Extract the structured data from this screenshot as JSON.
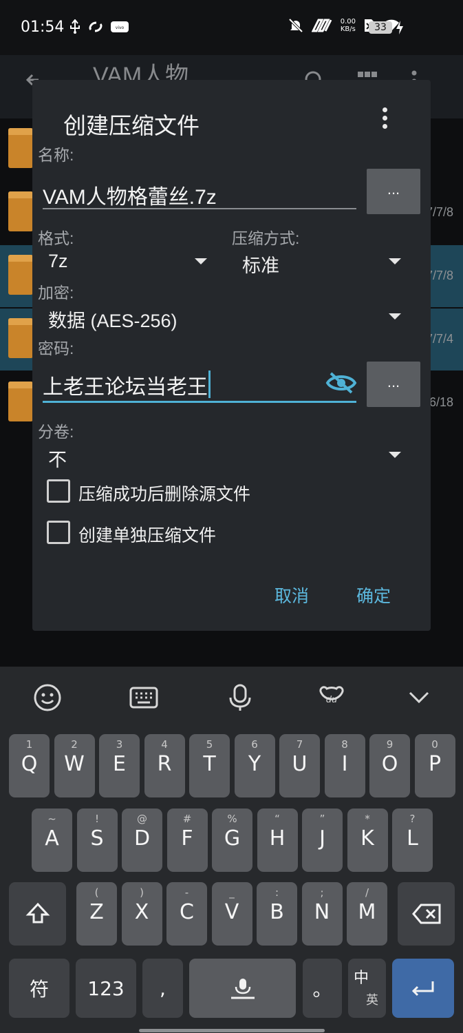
{
  "status_bar": {
    "time": "01:54",
    "net_speed_value": "0.00",
    "net_speed_unit": "KB/s",
    "battery": "33"
  },
  "background_app": {
    "title": "VAM人物",
    "dates": [
      "7/7/8",
      "7/7/8",
      "7/7/4",
      "6/18"
    ]
  },
  "dialog": {
    "title": "创建压缩文件",
    "name_label": "名称:",
    "name_value": "VAM人物格蕾丝.7z",
    "browse_label": "...",
    "format_label": "格式:",
    "format_value": "7z",
    "method_label": "压缩方式:",
    "method_value": "标准",
    "encryption_label": "加密:",
    "encryption_value": "数据 (AES-256)",
    "password_label": "密码:",
    "password_value": "上老王论坛当老王",
    "split_label": "分卷:",
    "split_value": "不",
    "checkbox_delete": "压缩成功后删除源文件",
    "checkbox_separate": "创建单独压缩文件",
    "cancel": "取消",
    "ok": "确定"
  },
  "keyboard": {
    "row1": [
      {
        "main": "Q",
        "sub": "1"
      },
      {
        "main": "W",
        "sub": "2"
      },
      {
        "main": "E",
        "sub": "3"
      },
      {
        "main": "R",
        "sub": "4"
      },
      {
        "main": "T",
        "sub": "5"
      },
      {
        "main": "Y",
        "sub": "6"
      },
      {
        "main": "U",
        "sub": "7"
      },
      {
        "main": "I",
        "sub": "8"
      },
      {
        "main": "O",
        "sub": "9"
      },
      {
        "main": "P",
        "sub": "0"
      }
    ],
    "row2": [
      {
        "main": "A",
        "sub": "~"
      },
      {
        "main": "S",
        "sub": "!"
      },
      {
        "main": "D",
        "sub": "@"
      },
      {
        "main": "F",
        "sub": "#"
      },
      {
        "main": "G",
        "sub": "%"
      },
      {
        "main": "H",
        "sub": "“"
      },
      {
        "main": "J",
        "sub": "”"
      },
      {
        "main": "K",
        "sub": "*"
      },
      {
        "main": "L",
        "sub": "?"
      }
    ],
    "row3": [
      {
        "main": "Z",
        "sub": "("
      },
      {
        "main": "X",
        "sub": ")"
      },
      {
        "main": "C",
        "sub": "-"
      },
      {
        "main": "V",
        "sub": "_"
      },
      {
        "main": "B",
        "sub": ":"
      },
      {
        "main": "N",
        "sub": ";"
      },
      {
        "main": "M",
        "sub": "/"
      }
    ],
    "symbol_key": "符",
    "number_key": "123",
    "comma_key": ",",
    "period_key": "。",
    "lang_key_top": "中",
    "lang_key_bottom": "英"
  }
}
